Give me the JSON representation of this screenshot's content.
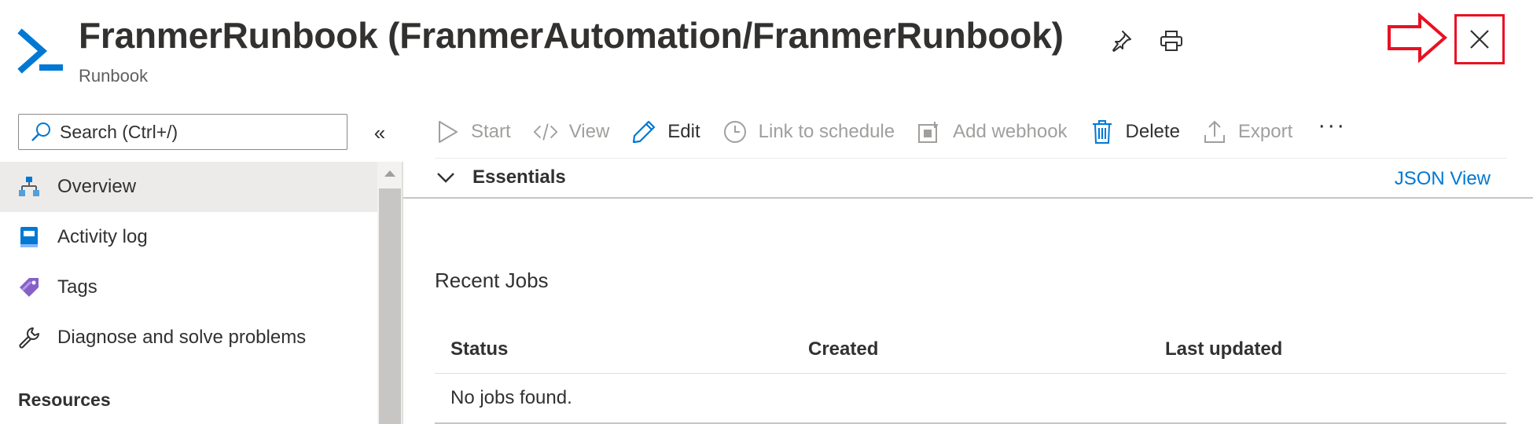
{
  "header": {
    "title": "FranmerRunbook (FranmerAutomation/FranmerRunbook)",
    "subtitle": "Runbook",
    "icons": {
      "app": "powershell-icon",
      "pin": "pin-icon",
      "print": "print-icon",
      "close": "close-icon",
      "callout": "red-arrow-icon"
    }
  },
  "colors": {
    "accent": "#0078d4",
    "callout": "#e81123",
    "active_bg": "#edebe9"
  },
  "sidebar": {
    "search_placeholder": "Search (Ctrl+/)",
    "collapse_label": "«",
    "items": [
      {
        "label": "Overview",
        "icon": "overview-icon",
        "active": true
      },
      {
        "label": "Activity log",
        "icon": "activity-log-icon"
      },
      {
        "label": "Tags",
        "icon": "tags-icon"
      },
      {
        "label": "Diagnose and solve problems",
        "icon": "wrench-icon"
      }
    ],
    "section": "Resources"
  },
  "toolbar": {
    "start": "Start",
    "view": "View",
    "edit": "Edit",
    "link_schedule": "Link to schedule",
    "add_webhook": "Add webhook",
    "delete": "Delete",
    "export": "Export",
    "more": "···"
  },
  "essentials": {
    "title": "Essentials",
    "json_view": "JSON View"
  },
  "recent_jobs": {
    "title": "Recent Jobs",
    "columns": [
      "Status",
      "Created",
      "Last updated"
    ],
    "empty": "No jobs found."
  }
}
